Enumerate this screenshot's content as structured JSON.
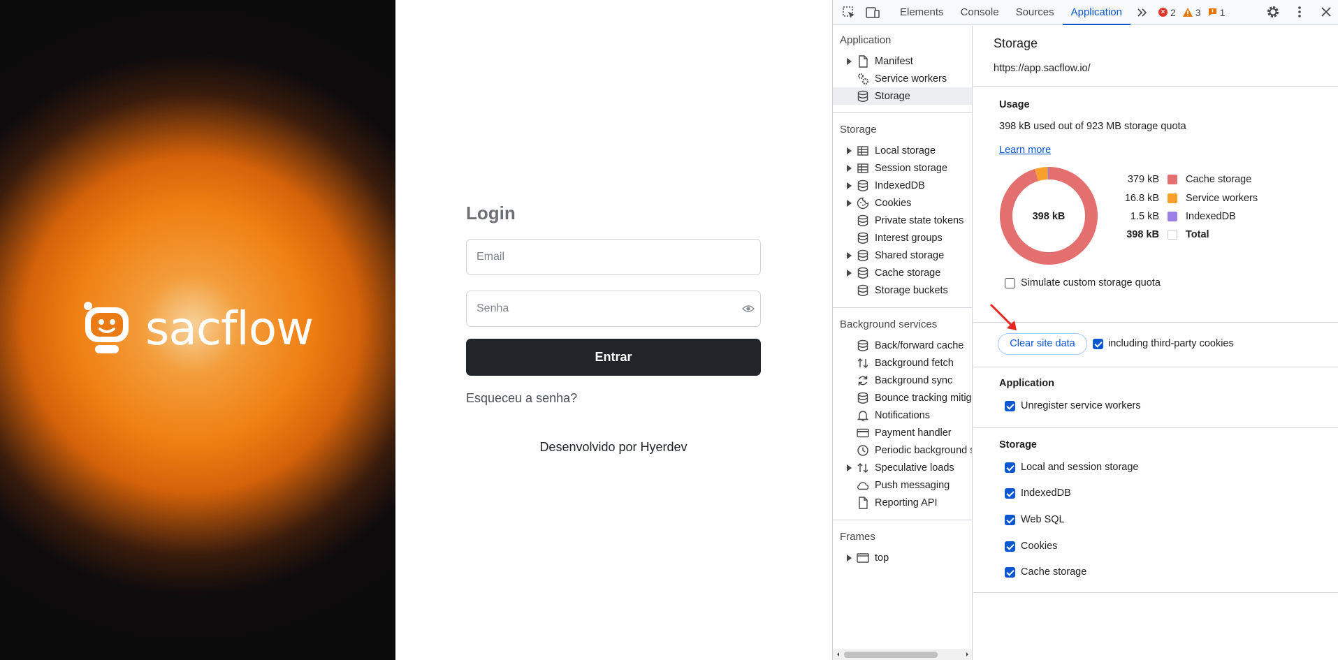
{
  "hero": {
    "brand": "sacflow"
  },
  "login": {
    "title": "Login",
    "email_placeholder": "Email",
    "password_placeholder": "Senha",
    "submit_label": "Entrar",
    "forgot_label": "Esqueceu a senha?",
    "footer": "Desenvolvido por Hyerdev"
  },
  "devtools": {
    "tabs": [
      "Elements",
      "Console",
      "Sources",
      "Application"
    ],
    "active_tab": "Application",
    "counts": {
      "errors": "2",
      "warnings": "3",
      "issues": "1"
    },
    "sidebar": {
      "application_header": "Application",
      "application_items": [
        "Manifest",
        "Service workers",
        "Storage"
      ],
      "storage_header": "Storage",
      "storage_items": [
        "Local storage",
        "Session storage",
        "IndexedDB",
        "Cookies",
        "Private state tokens",
        "Interest groups",
        "Shared storage",
        "Cache storage",
        "Storage buckets"
      ],
      "background_header": "Background services",
      "background_items": [
        "Back/forward cache",
        "Background fetch",
        "Background sync",
        "Bounce tracking mitigations",
        "Notifications",
        "Payment handler",
        "Periodic background sync",
        "Speculative loads",
        "Push messaging",
        "Reporting API"
      ],
      "frames_header": "Frames",
      "frames_items": [
        "top"
      ]
    },
    "main": {
      "title": "Storage",
      "origin": "https://app.sacflow.io/",
      "usage_header": "Usage",
      "usage_text": "398 kB used out of 923 MB storage quota",
      "learn_more": "Learn more",
      "donut_center": "398 kB",
      "simulate_label": "Simulate custom storage quota",
      "clear_button": "Clear site data",
      "third_party_label": "including third-party cookies",
      "application_header": "Application",
      "unregister_label": "Unregister service workers",
      "storage_header": "Storage",
      "storage_options": [
        "Local and session storage",
        "IndexedDB",
        "Web SQL",
        "Cookies",
        "Cache storage"
      ]
    }
  },
  "chart_data": {
    "type": "pie",
    "categories": [
      "Cache storage",
      "Service workers",
      "IndexedDB"
    ],
    "values": [
      379,
      16.8,
      1.5
    ],
    "value_labels": [
      "379 kB",
      "16.8 kB",
      "1.5 kB"
    ],
    "total_label": "Total",
    "total_value": "398 kB",
    "colors": [
      "#e46f6f",
      "#f8a02b",
      "#9b7fe6"
    ],
    "center_label": "398 kB"
  }
}
